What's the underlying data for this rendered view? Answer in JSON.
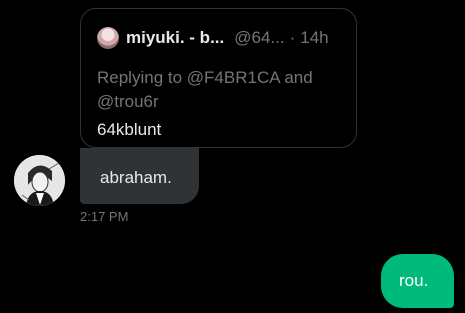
{
  "colors": {
    "background": "#000000",
    "incoming_bubble": "#2f3336",
    "outgoing_bubble": "#00ba7c",
    "secondary_text": "#71767b",
    "primary_text": "#e7e9ea",
    "card_border": "#2f3336"
  },
  "quoted_tweet": {
    "avatar_icon": "user-avatar-icon",
    "name": "miyuki. - b...",
    "handle": "@64...",
    "separator": "·",
    "time": "14h",
    "replying_to": "Replying to @F4BR1CA and @trou6r",
    "text": "64kblunt"
  },
  "incoming_message": {
    "avatar_icon": "sender-avatar-icon",
    "text": "abraham.",
    "timestamp": "2:17 PM"
  },
  "outgoing_message": {
    "text": "rou."
  }
}
